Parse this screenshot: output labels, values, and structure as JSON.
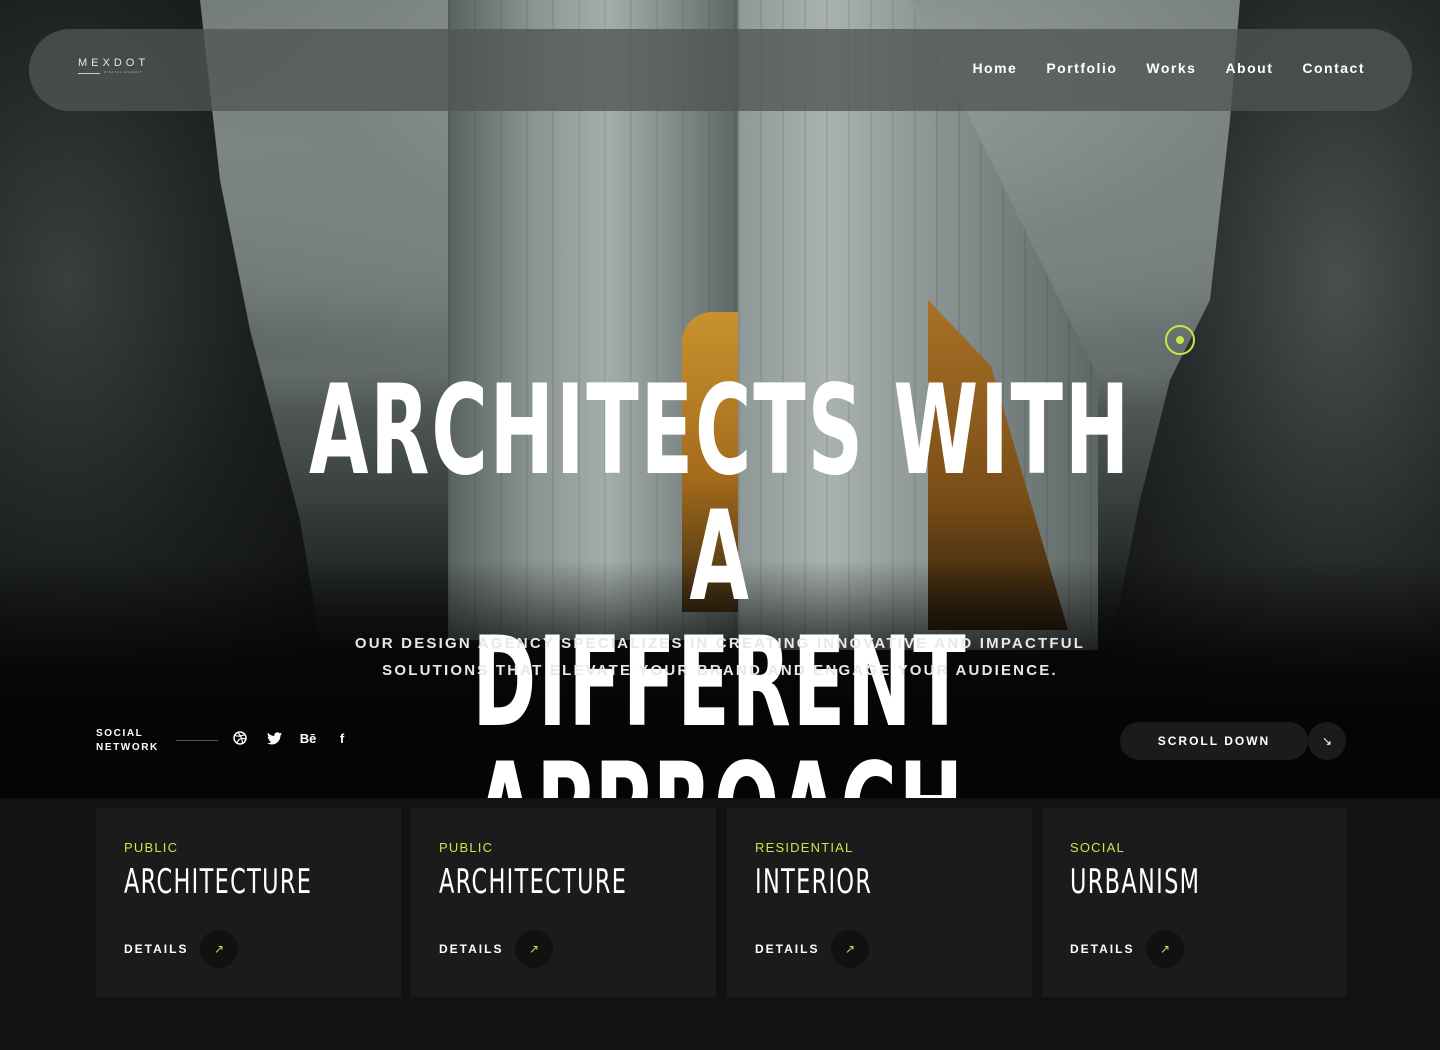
{
  "brand": {
    "name": "MEXDOT",
    "tagline": "DIGITAL AGENCY"
  },
  "nav": {
    "items": [
      "Home",
      "Portfolio",
      "Works",
      "About",
      "Contact"
    ]
  },
  "hero": {
    "headline_line1": "ARCHITECTS WITH A",
    "headline_line2": "DIFFERENT APPROACH",
    "tagline_line1": "OUR DESIGN AGENCY SPECIALIZES IN CREATING INNOVATIVE AND IMPACTFUL",
    "tagline_line2": "SOLUTIONS THAT ELEVATE YOUR BRAND AND ENGAGE YOUR AUDIENCE."
  },
  "social": {
    "label_line1": "SOCIAL",
    "label_line2": "NETWORK",
    "icons": [
      "dribbble-icon",
      "twitter-icon",
      "behance-icon",
      "facebook-icon"
    ],
    "behance_glyph": "Bē",
    "facebook_glyph": "f"
  },
  "scroll": {
    "label": "SCROLL DOWN",
    "arrow_glyph": "↘"
  },
  "cards": [
    {
      "category": "PUBLIC",
      "title": "ARCHITECTURE",
      "details": "DETAILS",
      "arrow_glyph": "↗"
    },
    {
      "category": "PUBLIC",
      "title": "ARCHITECTURE",
      "details": "DETAILS",
      "arrow_glyph": "↗"
    },
    {
      "category": "RESIDENTIAL",
      "title": "INTERIOR",
      "details": "DETAILS",
      "arrow_glyph": "↗"
    },
    {
      "category": "SOCIAL",
      "title": "URBANISM",
      "details": "DETAILS",
      "arrow_glyph": "↗"
    }
  ],
  "colors": {
    "accent": "#c6e84a",
    "card_bg": "#1b1b1b",
    "page_bg": "#121212"
  }
}
